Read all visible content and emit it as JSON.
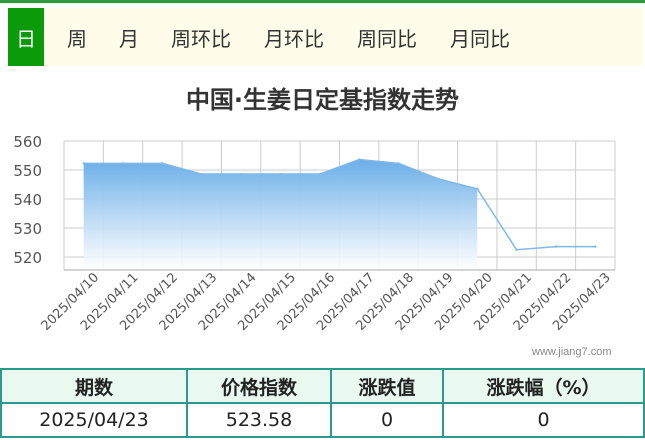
{
  "tabs": {
    "items": [
      {
        "label": "日",
        "active": true
      },
      {
        "label": "周"
      },
      {
        "label": "月"
      },
      {
        "label": "周环比"
      },
      {
        "label": "月环比"
      },
      {
        "label": "周同比"
      },
      {
        "label": "月同比"
      }
    ]
  },
  "chart_data": {
    "type": "area",
    "title": "中国·生姜日定基指数走势",
    "xlabel": "",
    "ylabel": "",
    "categories": [
      "2025/04/10",
      "2025/04/11",
      "2025/04/12",
      "2025/04/13",
      "2025/04/14",
      "2025/04/15",
      "2025/04/16",
      "2025/04/17",
      "2025/04/18",
      "2025/04/19",
      "2025/04/20",
      "2025/04/21",
      "2025/04/22",
      "2025/04/23"
    ],
    "series": [
      {
        "values": [
          552.3,
          552.3,
          552.3,
          548.6,
          548.6,
          548.6,
          548.6,
          553.6,
          552.3,
          547.0,
          543.5,
          522.5,
          523.58,
          523.58
        ]
      }
    ],
    "ylim": [
      520,
      560
    ],
    "yticks": [
      520,
      530,
      540,
      550,
      560
    ],
    "grid": true,
    "colors": {
      "line": "#7fb8ea",
      "fill_top": "#6aaee8",
      "fill_bottom": "#ffffff",
      "grid": "#cccccc"
    }
  },
  "watermark": "www.jiang7.com",
  "summary": {
    "headers": [
      "期数",
      "价格指数",
      "涨跌值",
      "涨跌幅（%）"
    ],
    "row": [
      "2025/04/23",
      "523.58",
      "0",
      "0"
    ]
  }
}
